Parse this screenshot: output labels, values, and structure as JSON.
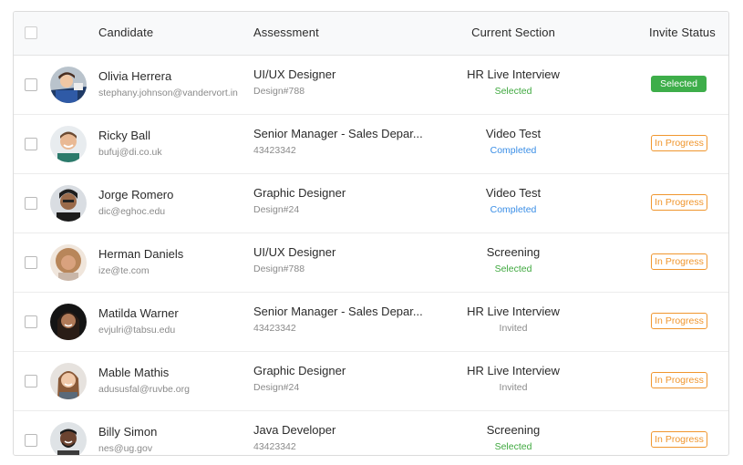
{
  "header": {
    "candidate": "Candidate",
    "assessment": "Assessment",
    "section": "Current Section",
    "invite": "Invite Status"
  },
  "rows": [
    {
      "name": "Olivia Herrera",
      "email": "stephany.johnson@vandervort.in",
      "assessment": "UI/UX Designer",
      "assessment_id": "Design#788",
      "section": "HR Live Interview",
      "section_status": "Selected",
      "invite_status": "Selected"
    },
    {
      "name": "Ricky Ball",
      "email": "bufuj@di.co.uk",
      "assessment": "Senior Manager - Sales Depar...",
      "assessment_id": "43423342",
      "section": "Video Test",
      "section_status": "Completed",
      "invite_status": "In Progress"
    },
    {
      "name": "Jorge Romero",
      "email": "dic@eghoc.edu",
      "assessment": "Graphic Designer",
      "assessment_id": "Design#24",
      "section": "Video Test",
      "section_status": "Completed",
      "invite_status": "In Progress"
    },
    {
      "name": "Herman Daniels",
      "email": "ize@te.com",
      "assessment": "UI/UX Designer",
      "assessment_id": "Design#788",
      "section": "Screening",
      "section_status": "Selected",
      "invite_status": "In Progress"
    },
    {
      "name": "Matilda Warner",
      "email": "evjulri@tabsu.edu",
      "assessment": "Senior Manager - Sales Depar...",
      "assessment_id": "43423342",
      "section": "HR Live Interview",
      "section_status": "Invited",
      "invite_status": "In Progress"
    },
    {
      "name": "Mable Mathis",
      "email": "adususfal@ruvbe.org",
      "assessment": "Graphic Designer",
      "assessment_id": "Design#24",
      "section": "HR Live Interview",
      "section_status": "Invited",
      "invite_status": "In Progress"
    },
    {
      "name": "Billy Simon",
      "email": "nes@ug.gov",
      "assessment": "Java Developer",
      "assessment_id": "43423342",
      "section": "Screening",
      "section_status": "Selected",
      "invite_status": "In Progress"
    }
  ],
  "colors": {
    "selected": "#3eae4a",
    "in_progress": "#f0962e",
    "completed": "#3a8ee6",
    "invited": "#8a8a8a"
  }
}
